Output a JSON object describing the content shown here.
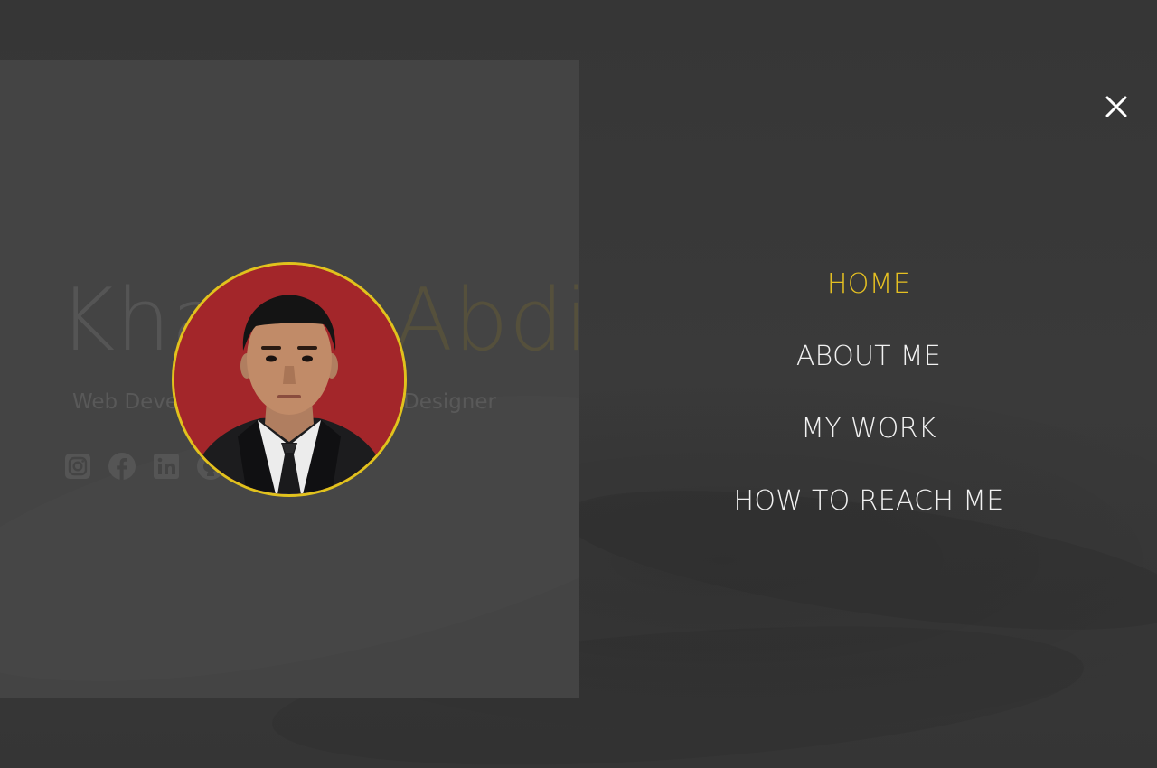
{
  "hero": {
    "first_name": "Khairul",
    "last_name": "Abdi",
    "tagline": "Web Developer, Programmer & Designer"
  },
  "social": [
    {
      "icon": "instagram-icon"
    },
    {
      "icon": "facebook-icon"
    },
    {
      "icon": "linkedin-icon"
    },
    {
      "icon": "github-icon"
    }
  ],
  "avatar": {
    "border_color": "#e1c21d",
    "background_color": "#a3262a"
  },
  "menu": {
    "close_icon": "close-icon",
    "items": [
      {
        "label": "HOME",
        "active": true
      },
      {
        "label": "ABOUT ME",
        "active": false
      },
      {
        "label": "MY WORK",
        "active": false
      },
      {
        "label": "HOW TO REACH ME",
        "active": false
      }
    ]
  },
  "colors": {
    "accent": "#e5c022",
    "menu_text": "#f1f1f1",
    "background": "#363636",
    "panel": "#444444"
  }
}
